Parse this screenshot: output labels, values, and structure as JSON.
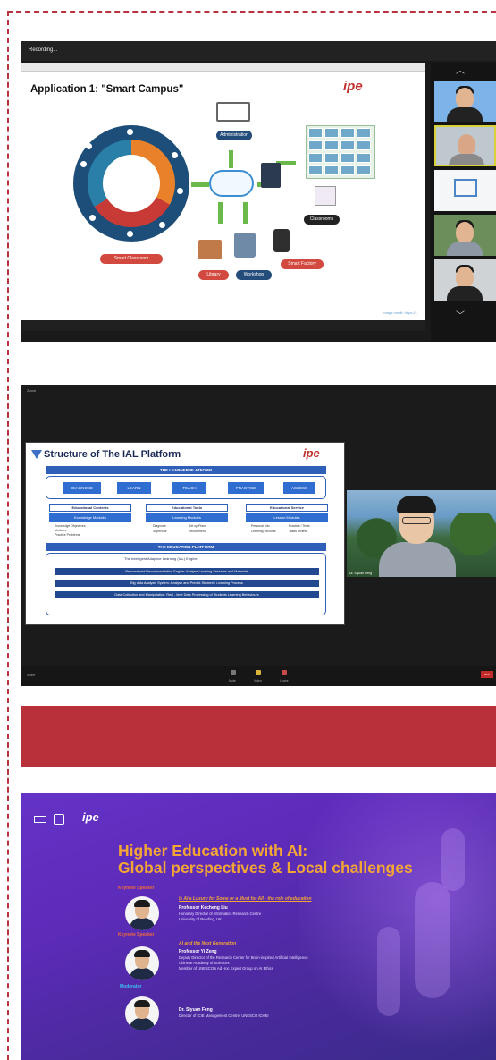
{
  "panel1": {
    "window_label": "Recording...",
    "slide": {
      "title": "Application 1: \"Smart Campus\"",
      "logo": "ipe",
      "wheel_inner_label": "Campus & IoT",
      "labels": [
        "Smart Classroom",
        "Smart Library",
        "Administration",
        "Classrooms",
        "Smart Factory",
        "Library",
        "Workshop"
      ],
      "credit": "Image credit: https://..."
    },
    "icons": [
      "chevron-up-icon",
      "chevron-down-icon"
    ]
  },
  "panel2": {
    "window_label": "Zoom",
    "slide": {
      "title": "Structure of The IAL Platform",
      "learner_platform": "THE LEARNER PLATFORM",
      "actions": [
        "DIAGNOSE",
        "LEARN",
        "TEACH",
        "PRACTISE",
        "ASSESS"
      ],
      "columns": [
        {
          "head": "Educational Contents",
          "sub": "Knowledge Modules",
          "items": [
            "Knowledge Objectives",
            "Modules",
            "Practice Problems"
          ]
        },
        {
          "head": "Educational Tools",
          "sub": "Learning Modules",
          "items": [
            "Diagnose",
            "Supervise",
            "Set up Plans",
            "Recommend"
          ]
        },
        {
          "head": "Educational Service",
          "sub": "Lesson Modules",
          "items": [
            "Personal Info",
            "Learning Records",
            "Practise / Tests",
            "Tasks review"
          ]
        }
      ],
      "education_platform": "THE EDUCATION PLATFORM",
      "engine": "The Intelligent Adaptive Learning (IAL) Engine",
      "stripes": [
        "Personalised Recommendation Engine: Analyse Learning Sessions and Materials",
        "Big data Analysis System: Analyse and Predict Students' Learning Process",
        "Data Collection and Manipulation: Real - time Data Processing of Students Learning Behaviours"
      ]
    },
    "speaker_label": "Dr. Siyuan Feng",
    "bottom_left": "Share",
    "bottom_items": [
      "Mute",
      "Video",
      "Leave"
    ],
    "end_label": "End"
  },
  "poster": {
    "title_line1": "Higher Education with AI:",
    "title_line2": "Global perspectives & Local challenges",
    "speakers": [
      {
        "role": "Keynote Speaker",
        "talk": "Is AI a Luxury for Some or a Must for All - the role of education",
        "name": "Professor Kecheng Liu",
        "desc": [
          "Honorary Director of Informatics Research Centre",
          "University of Reading, UK"
        ]
      },
      {
        "role": "Keynote Speaker",
        "talk": "AI and the Next Generation",
        "name": "Professor Yi Zeng",
        "desc": [
          "Deputy Director of the Research Center for Brain-inspired Artificial Intelligence",
          "Chinese Academy of Sciences",
          "Member of UNESCO's Ad Hoc Expert Group on AI Ethics"
        ]
      },
      {
        "role": "Moderator",
        "talk": "",
        "name": "Dr. Siyuan Feng",
        "desc": [
          "Director of ICIE Management Centre, UNESCO ICHEI"
        ]
      }
    ],
    "logo": "ipe"
  },
  "colors": {
    "frame_dash": "#b83240",
    "banner": "#b7303a",
    "poster_title": "#f4a634",
    "slide_blue": "#2f5fb8"
  }
}
